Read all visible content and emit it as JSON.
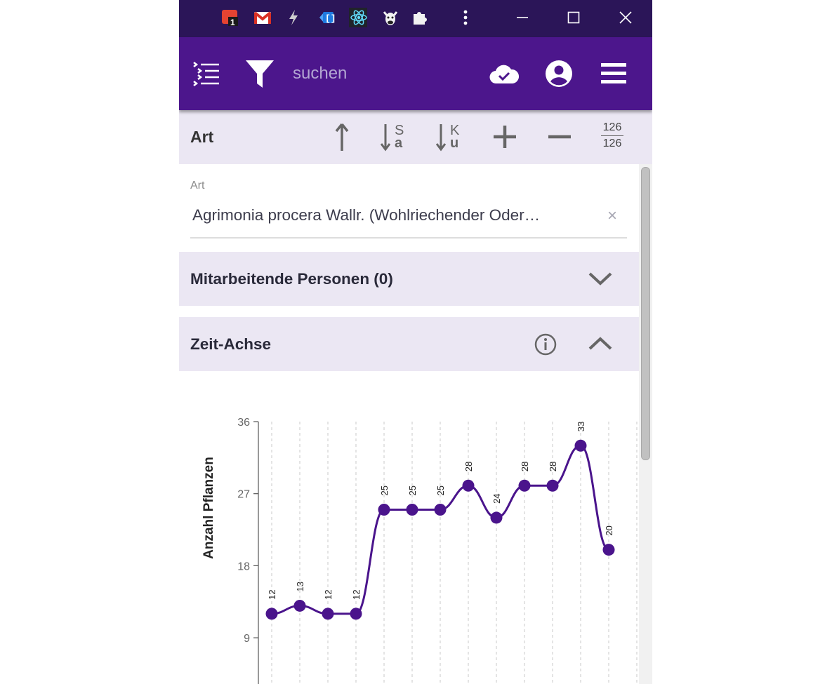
{
  "titlebar": {
    "extensions": [
      "todoist-icon",
      "gmail-icon",
      "lightning-icon",
      "bracket-extension-icon",
      "react-devtools-icon",
      "cow-icon",
      "puzzle-icon"
    ],
    "todoist_badge": "1"
  },
  "appbar": {
    "search_placeholder": "suchen"
  },
  "toolbar": {
    "title": "Art",
    "sort_alpha_label_top": "S",
    "sort_alpha_label_bottom": "a",
    "sort_k_label_top": "K",
    "sort_k_label_bottom": "u",
    "count_shown": "126",
    "count_total": "126"
  },
  "form": {
    "art_label": "Art",
    "art_value": "Agrimonia procera Wallr. (Wohlriechender Oder…",
    "art_clear": "×"
  },
  "panels": {
    "mitarbeitende_title": "Mitarbeitende Personen (0)",
    "zeitachse_title": "Zeit-Achse"
  },
  "colors": {
    "titlebar": "#2b1558",
    "appbar": "#4c168c",
    "toolbar": "#ebe7f3",
    "chart_line": "#4a148c"
  },
  "chart_data": {
    "type": "line",
    "ylabel": "Anzahl Pflanzen",
    "yticks": [
      9,
      18,
      27,
      36
    ],
    "ylim": [
      9,
      36
    ],
    "series": [
      {
        "values": [
          12,
          13,
          12,
          12,
          25,
          25,
          25,
          28,
          24,
          28,
          28,
          33,
          20
        ]
      }
    ],
    "data_labels": [
      "12",
      "13",
      "12",
      "12",
      "25",
      "25",
      "25",
      "28",
      "24",
      "28",
      "28",
      "33",
      "20"
    ],
    "grid": "vertical-dashed"
  }
}
